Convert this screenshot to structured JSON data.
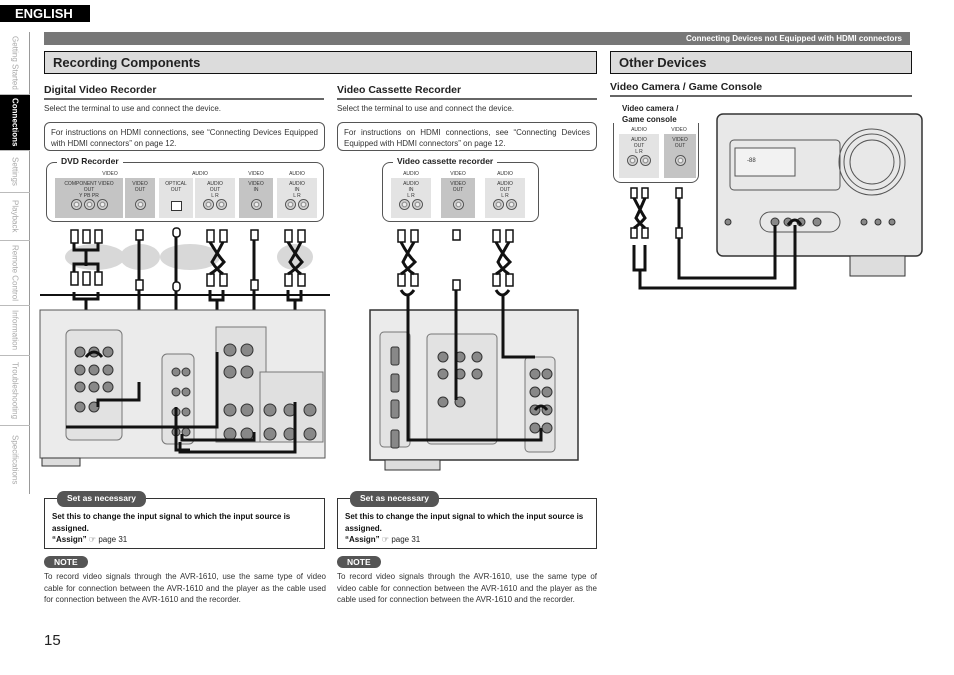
{
  "language_tab": "ENGLISH",
  "side_nav": [
    {
      "label": "Getting Started",
      "active": false
    },
    {
      "label": "Connections",
      "active": true
    },
    {
      "label": "Settings",
      "active": false
    },
    {
      "label": "Playback",
      "active": false
    },
    {
      "label": "Remote Control",
      "active": false
    },
    {
      "label": "Information",
      "active": false
    },
    {
      "label": "Troubleshooting",
      "active": false
    },
    {
      "label": "Specifications",
      "active": false
    }
  ],
  "header_bar": "Connecting Devices not Equipped with HDMI connectors",
  "recording": {
    "title": "Recording Components",
    "dvr": {
      "title": "Digital Video Recorder",
      "instruction": "Select the terminal to use and connect the device.",
      "hdmi_note": "For instructions on HDMI connections, see “Connecting Devices Equipped with HDMI connectors” on page 12.",
      "device_label": "DVD Recorder",
      "groups": [
        "VIDEO",
        "AUDIO",
        "VIDEO",
        "AUDIO"
      ],
      "panels": [
        {
          "name": "COMPONENT VIDEO",
          "sub": "OUT",
          "pins": "Y   PB   PR"
        },
        {
          "name": "VIDEO",
          "sub": "OUT",
          "pins": ""
        },
        {
          "name": "OPTICAL",
          "sub": "OUT",
          "pins": ""
        },
        {
          "name": "AUDIO",
          "sub": "OUT",
          "pins": "L   R"
        },
        {
          "name": "VIDEO",
          "sub": "IN",
          "pins": ""
        },
        {
          "name": "AUDIO",
          "sub": "IN",
          "pins": "L   R"
        }
      ],
      "set_as_necessary": {
        "tag": "Set as necessary",
        "text": "Set this to change the input signal to which the input source is assigned.",
        "ref_label": "“Assign”",
        "ref_page": "page 31"
      },
      "note_tag": "NOTE",
      "note_text": "To record video signals through the AVR-1610, use the same type of video cable for connection between the AVR-1610 and the player as the cable used for connection between the AVR-1610 and the recorder."
    },
    "vcr": {
      "title": "Video Cassette Recorder",
      "instruction": "Select the terminal to use and connect the device.",
      "hdmi_note": "For instructions on HDMI connections, see “Connecting Devices Equipped with HDMI connectors” on page 12.",
      "device_label": "Video cassette recorder",
      "groups": [
        "AUDIO",
        "VIDEO",
        "AUDIO"
      ],
      "panels": [
        {
          "name": "AUDIO",
          "sub": "IN",
          "pins": "L   R"
        },
        {
          "name": "VIDEO",
          "sub": "OUT",
          "pins": ""
        },
        {
          "name": "AUDIO",
          "sub": "OUT",
          "pins": "L   R"
        }
      ],
      "set_as_necessary": {
        "tag": "Set as necessary",
        "text": "Set this to change the input signal to which the input source is assigned.",
        "ref_label": "“Assign”",
        "ref_page": "page 31"
      },
      "note_tag": "NOTE",
      "note_text": "To record video signals through the AVR-1610, use the same type of video cable for connection between the AVR-1610 and the player as the cable used for connection between the AVR-1610 and the recorder."
    }
  },
  "other": {
    "title": "Other Devices",
    "camera": {
      "title": "Video Camera / Game Console",
      "device_label_1": "Video camera /",
      "device_label_2": "Game console",
      "groups": [
        "AUDIO",
        "VIDEO"
      ],
      "panels": [
        {
          "name": "AUDIO",
          "sub": "OUT",
          "pins": "L   R"
        },
        {
          "name": "VIDEO",
          "sub": "OUT",
          "pins": ""
        }
      ],
      "display_readout": "-88"
    }
  },
  "page_number": "15"
}
